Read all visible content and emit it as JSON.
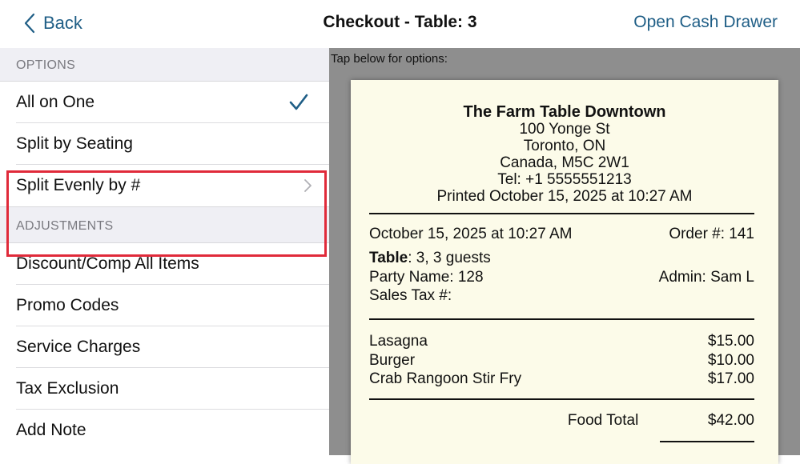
{
  "header": {
    "back_label": "Back",
    "title": "Checkout - Table: 3",
    "cash_drawer_label": "Open Cash Drawer"
  },
  "options": {
    "section_label": "OPTIONS",
    "items": [
      {
        "label": "All on One",
        "selected": true
      },
      {
        "label": "Split by Seating"
      },
      {
        "label": "Split Evenly by #",
        "has_chevron": true
      }
    ]
  },
  "adjustments": {
    "section_label": "ADJUSTMENTS",
    "items": [
      {
        "label": "Discount/Comp All Items"
      },
      {
        "label": "Promo Codes"
      },
      {
        "label": "Service Charges"
      },
      {
        "label": "Tax Exclusion"
      },
      {
        "label": "Add Note"
      }
    ]
  },
  "receipt": {
    "hint": "Tap below for options:",
    "restaurant": "The Farm Table Downtown",
    "address1": "100 Yonge St",
    "address2": "Toronto, ON",
    "address3": "Canada, M5C 2W1",
    "tel": "Tel: +1 5555551213",
    "printed": "Printed October 15, 2025 at 10:27 AM",
    "date": "October 15, 2025 at 10:27 AM",
    "order": "Order #: 141",
    "table_label": "Table",
    "table_value": ": 3, 3 guests",
    "party": "Party Name: 128",
    "admin": "Admin: Sam L",
    "sales_tax": "Sales Tax #:",
    "items": [
      {
        "name": "Lasagna",
        "price": "$15.00"
      },
      {
        "name": "Burger",
        "price": "$10.00"
      },
      {
        "name": "Crab Rangoon Stir Fry",
        "price": "$17.00"
      }
    ],
    "food_total_label": "Food Total",
    "food_total_value": "$42.00"
  },
  "colors": {
    "accent": "#1f5e86",
    "highlight": "#e02a3a",
    "receipt_bg": "#fcfbe9"
  }
}
